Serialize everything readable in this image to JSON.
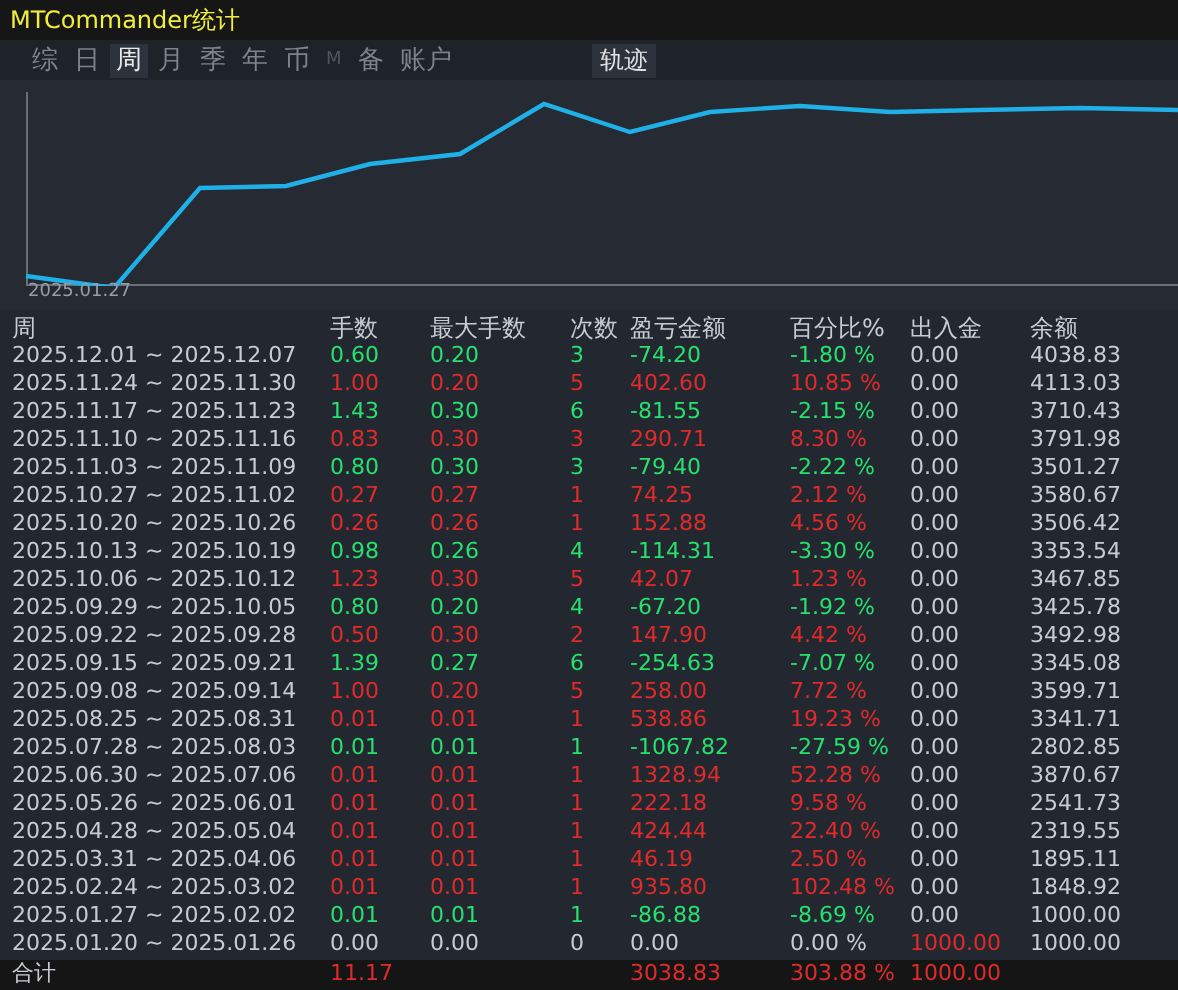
{
  "window": {
    "title": "MTCommander统计"
  },
  "tabs": [
    {
      "label": "综",
      "selected": false,
      "disabled": false
    },
    {
      "label": "日",
      "selected": false,
      "disabled": false
    },
    {
      "label": "周",
      "selected": true,
      "disabled": false
    },
    {
      "label": "月",
      "selected": false,
      "disabled": false
    },
    {
      "label": "季",
      "selected": false,
      "disabled": false
    },
    {
      "label": "年",
      "selected": false,
      "disabled": false
    },
    {
      "label": "币",
      "selected": false,
      "disabled": false
    },
    {
      "label": "M",
      "selected": false,
      "disabled": true
    },
    {
      "label": "备",
      "selected": false,
      "disabled": false
    },
    {
      "label": "账户",
      "selected": false,
      "disabled": false
    }
  ],
  "track_button": {
    "label": "轨迹"
  },
  "chart": {
    "start_label": "2025.01.27"
  },
  "table": {
    "columns": [
      "周",
      "手数",
      "最大手数",
      "次数",
      "盈亏金额",
      "百分比%",
      "出入金",
      "余额"
    ],
    "rows": [
      {
        "kind": "loss",
        "deposit_in": false,
        "cells": [
          "2025.12.01 ~ 2025.12.07",
          "0.60",
          "0.20",
          "3",
          "-74.20",
          "-1.80 %",
          "0.00",
          "4038.83"
        ]
      },
      {
        "kind": "profit",
        "deposit_in": false,
        "cells": [
          "2025.11.24 ~ 2025.11.30",
          "1.00",
          "0.20",
          "5",
          "402.60",
          "10.85 %",
          "0.00",
          "4113.03"
        ]
      },
      {
        "kind": "loss",
        "deposit_in": false,
        "cells": [
          "2025.11.17 ~ 2025.11.23",
          "1.43",
          "0.30",
          "6",
          "-81.55",
          "-2.15 %",
          "0.00",
          "3710.43"
        ]
      },
      {
        "kind": "profit",
        "deposit_in": false,
        "cells": [
          "2025.11.10 ~ 2025.11.16",
          "0.83",
          "0.30",
          "3",
          "290.71",
          "8.30 %",
          "0.00",
          "3791.98"
        ]
      },
      {
        "kind": "loss",
        "deposit_in": false,
        "cells": [
          "2025.11.03 ~ 2025.11.09",
          "0.80",
          "0.30",
          "3",
          "-79.40",
          "-2.22 %",
          "0.00",
          "3501.27"
        ]
      },
      {
        "kind": "profit",
        "deposit_in": false,
        "cells": [
          "2025.10.27 ~ 2025.11.02",
          "0.27",
          "0.27",
          "1",
          "74.25",
          "2.12 %",
          "0.00",
          "3580.67"
        ]
      },
      {
        "kind": "profit",
        "deposit_in": false,
        "cells": [
          "2025.10.20 ~ 2025.10.26",
          "0.26",
          "0.26",
          "1",
          "152.88",
          "4.56 %",
          "0.00",
          "3506.42"
        ]
      },
      {
        "kind": "loss",
        "deposit_in": false,
        "cells": [
          "2025.10.13 ~ 2025.10.19",
          "0.98",
          "0.26",
          "4",
          "-114.31",
          "-3.30 %",
          "0.00",
          "3353.54"
        ]
      },
      {
        "kind": "profit",
        "deposit_in": false,
        "cells": [
          "2025.10.06 ~ 2025.10.12",
          "1.23",
          "0.30",
          "5",
          "42.07",
          "1.23 %",
          "0.00",
          "3467.85"
        ]
      },
      {
        "kind": "loss",
        "deposit_in": false,
        "cells": [
          "2025.09.29 ~ 2025.10.05",
          "0.80",
          "0.20",
          "4",
          "-67.20",
          "-1.92 %",
          "0.00",
          "3425.78"
        ]
      },
      {
        "kind": "profit",
        "deposit_in": false,
        "cells": [
          "2025.09.22 ~ 2025.09.28",
          "0.50",
          "0.30",
          "2",
          "147.90",
          "4.42 %",
          "0.00",
          "3492.98"
        ]
      },
      {
        "kind": "loss",
        "deposit_in": false,
        "cells": [
          "2025.09.15 ~ 2025.09.21",
          "1.39",
          "0.27",
          "6",
          "-254.63",
          "-7.07 %",
          "0.00",
          "3345.08"
        ]
      },
      {
        "kind": "profit",
        "deposit_in": false,
        "cells": [
          "2025.09.08 ~ 2025.09.14",
          "1.00",
          "0.20",
          "5",
          "258.00",
          "7.72 %",
          "0.00",
          "3599.71"
        ]
      },
      {
        "kind": "profit",
        "deposit_in": false,
        "cells": [
          "2025.08.25 ~ 2025.08.31",
          "0.01",
          "0.01",
          "1",
          "538.86",
          "19.23 %",
          "0.00",
          "3341.71"
        ]
      },
      {
        "kind": "loss",
        "deposit_in": false,
        "cells": [
          "2025.07.28 ~ 2025.08.03",
          "0.01",
          "0.01",
          "1",
          "-1067.82",
          "-27.59 %",
          "0.00",
          "2802.85"
        ]
      },
      {
        "kind": "profit",
        "deposit_in": false,
        "cells": [
          "2025.06.30 ~ 2025.07.06",
          "0.01",
          "0.01",
          "1",
          "1328.94",
          "52.28 %",
          "0.00",
          "3870.67"
        ]
      },
      {
        "kind": "profit",
        "deposit_in": false,
        "cells": [
          "2025.05.26 ~ 2025.06.01",
          "0.01",
          "0.01",
          "1",
          "222.18",
          "9.58 %",
          "0.00",
          "2541.73"
        ]
      },
      {
        "kind": "profit",
        "deposit_in": false,
        "cells": [
          "2025.04.28 ~ 2025.05.04",
          "0.01",
          "0.01",
          "1",
          "424.44",
          "22.40 %",
          "0.00",
          "2319.55"
        ]
      },
      {
        "kind": "profit",
        "deposit_in": false,
        "cells": [
          "2025.03.31 ~ 2025.04.06",
          "0.01",
          "0.01",
          "1",
          "46.19",
          "2.50 %",
          "0.00",
          "1895.11"
        ]
      },
      {
        "kind": "profit",
        "deposit_in": false,
        "cells": [
          "2025.02.24 ~ 2025.03.02",
          "0.01",
          "0.01",
          "1",
          "935.80",
          "102.48 %",
          "0.00",
          "1848.92"
        ]
      },
      {
        "kind": "loss",
        "deposit_in": false,
        "cells": [
          "2025.01.27 ~ 2025.02.02",
          "0.01",
          "0.01",
          "1",
          "-86.88",
          "-8.69 %",
          "0.00",
          "1000.00"
        ]
      },
      {
        "kind": "flat",
        "deposit_in": true,
        "cells": [
          "2025.01.20 ~ 2025.01.26",
          "0.00",
          "0.00",
          "0",
          "0.00",
          "0.00 %",
          "1000.00",
          "1000.00"
        ]
      }
    ],
    "total": {
      "label": "合计",
      "lots": "11.17",
      "profit": "3038.83",
      "percent": "303.88 %",
      "deposit": "1000.00"
    }
  }
}
